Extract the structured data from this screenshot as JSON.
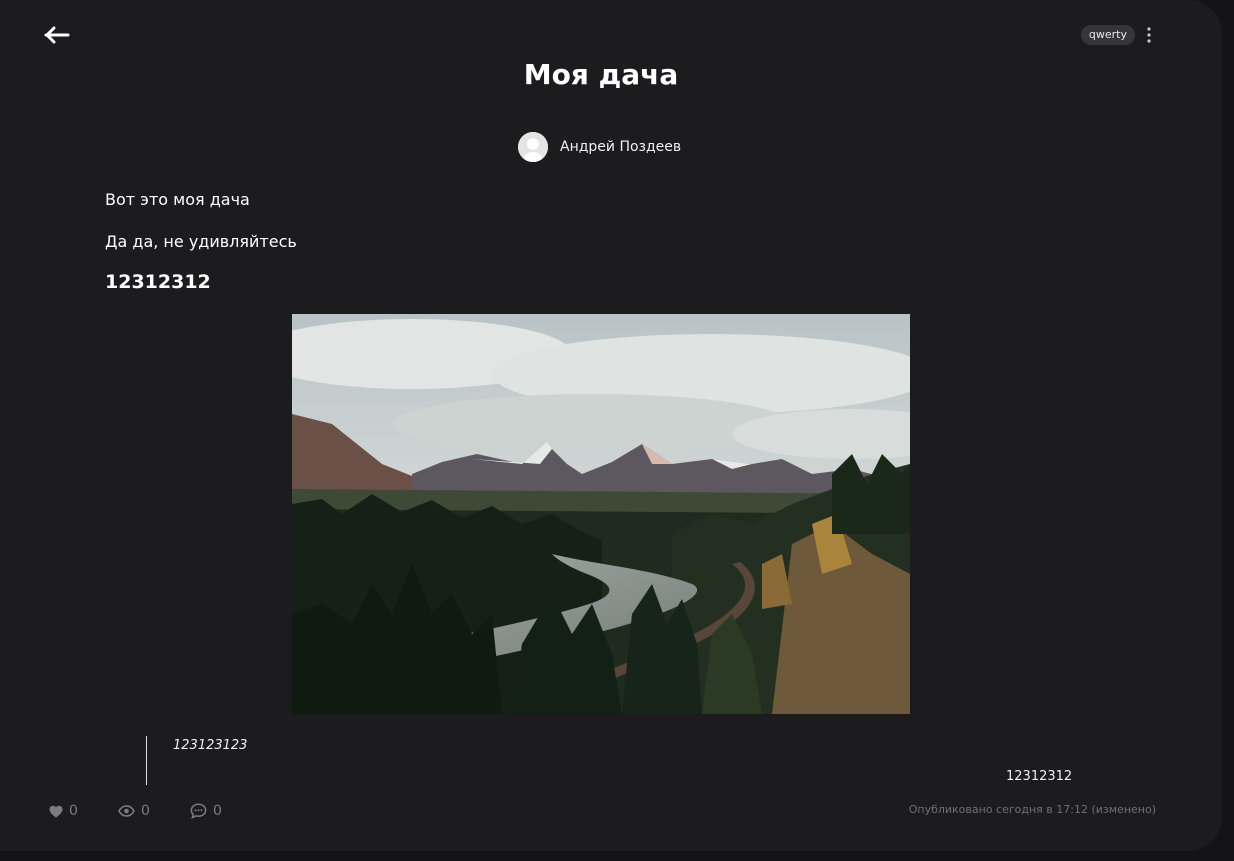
{
  "post": {
    "title": "Моя дача",
    "tag": "qwerty",
    "author_name": "Андрей Поздеев",
    "paragraphs": [
      "Вот это моя дача",
      "Да да, не удивляйтесь"
    ],
    "heading": "12312312",
    "quote": "123123123",
    "aligned_text": "12312312",
    "published": "Опубликовано сегодня в 17:12 (изменено)"
  },
  "stats": {
    "likes": "0",
    "views": "0",
    "comments": "0"
  },
  "icons": {
    "back": "arrow-left-icon",
    "menu": "more-vertical-icon",
    "like": "heart-icon",
    "views": "eye-icon",
    "comments": "comment-icon",
    "avatar": "user-icon"
  },
  "colors": {
    "background": "#1c1c1f",
    "text": "#ffffff",
    "muted": "#7b7b80",
    "tag_bg": "#35353a"
  }
}
